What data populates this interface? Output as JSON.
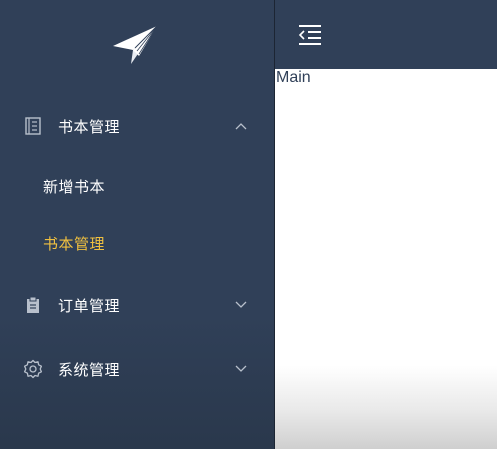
{
  "sidebar": {
    "logo_icon": "paper-plane-icon",
    "menus": [
      {
        "label": "书本管理",
        "icon": "book-icon",
        "expanded": true,
        "children": [
          {
            "label": "新增书本",
            "active": false
          },
          {
            "label": "书本管理",
            "active": true
          }
        ]
      },
      {
        "label": "订单管理",
        "icon": "clipboard-icon",
        "expanded": false
      },
      {
        "label": "系统管理",
        "icon": "gear-icon",
        "expanded": false
      }
    ],
    "active_color": "#f0c040",
    "background_color": "#304058"
  },
  "header": {
    "toggle_icon": "indent-icon"
  },
  "main": {
    "content": "Main"
  }
}
